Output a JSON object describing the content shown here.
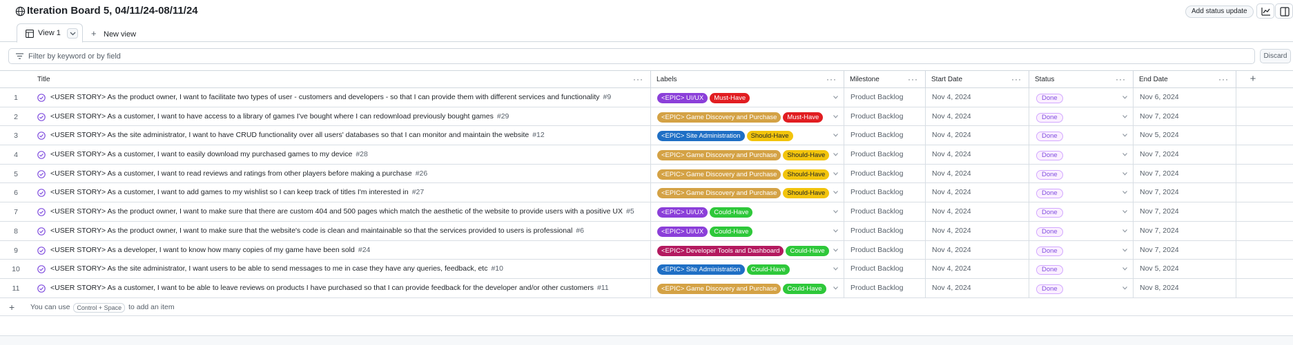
{
  "header": {
    "title": "Iteration Board 5, 04/11/24-08/11/24",
    "status_update_label": "Add status update"
  },
  "tabs": {
    "active": "View 1",
    "new_view": "New view"
  },
  "filter": {
    "placeholder": "Filter by keyword or by field",
    "discard_label": "Discard"
  },
  "columns": [
    "Title",
    "Labels",
    "Milestone",
    "Start Date",
    "Status",
    "End Date"
  ],
  "label_colors": {
    "<EPIC> UI/UX": "#8b3fd9",
    "<EPIC> Game Discovery and Purchase": "#d4a245",
    "<EPIC> Site Administration": "#1f6fc5",
    "<EPIC> Developer Tools and Dashboard": "#b3195f",
    "Must-Have": "#e11d21",
    "Should-Have": "#f2c40c",
    "Could-Have": "#2ec83a"
  },
  "dark_text_labels": [
    "Should-Have"
  ],
  "rows": [
    {
      "num": "1",
      "title": "<USER STORY> As the product owner, I want to facilitate two types of user - customers and developers - so that I can provide them with different services and functionality",
      "issue": "#9",
      "labels": [
        "<EPIC> UI/UX",
        "Must-Have"
      ],
      "milestone": "Product Backlog",
      "start": "Nov 4, 2024",
      "status": "Done",
      "end": "Nov 6, 2024"
    },
    {
      "num": "2",
      "title": "<USER STORY> As a customer, I want to have access to a library of games I've bought where I can redownload previously bought games",
      "issue": "#29",
      "labels": [
        "<EPIC> Game Discovery and Purchase",
        "Must-Have"
      ],
      "milestone": "Product Backlog",
      "start": "Nov 4, 2024",
      "status": "Done",
      "end": "Nov 7, 2024"
    },
    {
      "num": "3",
      "title": "<USER STORY> As the site administrator, I want to have CRUD functionality over all users' databases so that I can monitor and maintain the website",
      "issue": "#12",
      "labels": [
        "<EPIC> Site Administration",
        "Should-Have"
      ],
      "milestone": "Product Backlog",
      "start": "Nov 4, 2024",
      "status": "Done",
      "end": "Nov 5, 2024"
    },
    {
      "num": "4",
      "title": "<USER STORY> As a customer, I want to easily download my purchased games to my device",
      "issue": "#28",
      "labels": [
        "<EPIC> Game Discovery and Purchase",
        "Should-Have"
      ],
      "milestone": "Product Backlog",
      "start": "Nov 4, 2024",
      "status": "Done",
      "end": "Nov 7, 2024"
    },
    {
      "num": "5",
      "title": "<USER STORY> As a customer, I want to read reviews and ratings from other players before making a purchase",
      "issue": "#26",
      "labels": [
        "<EPIC> Game Discovery and Purchase",
        "Should-Have"
      ],
      "milestone": "Product Backlog",
      "start": "Nov 4, 2024",
      "status": "Done",
      "end": "Nov 7, 2024"
    },
    {
      "num": "6",
      "title": "<USER STORY> As a customer, I want to add games to my wishlist so I can keep track of titles I'm interested in",
      "issue": "#27",
      "labels": [
        "<EPIC> Game Discovery and Purchase",
        "Should-Have"
      ],
      "milestone": "Product Backlog",
      "start": "Nov 4, 2024",
      "status": "Done",
      "end": "Nov 7, 2024"
    },
    {
      "num": "7",
      "title": "<USER STORY> As the product owner, I want to make sure that there are custom 404 and 500 pages which match the aesthetic of the website to provide users with a positive UX",
      "issue": "#5",
      "labels": [
        "<EPIC> UI/UX",
        "Could-Have"
      ],
      "milestone": "Product Backlog",
      "start": "Nov 4, 2024",
      "status": "Done",
      "end": "Nov 7, 2024"
    },
    {
      "num": "8",
      "title": "<USER STORY> As the product owner, I want to make sure that the website's code is clean and maintainable so that the services provided to users is professional",
      "issue": "#6",
      "labels": [
        "<EPIC> UI/UX",
        "Could-Have"
      ],
      "milestone": "Product Backlog",
      "start": "Nov 4, 2024",
      "status": "Done",
      "end": "Nov 7, 2024"
    },
    {
      "num": "9",
      "title": "<USER STORY> As a developer, I want to know how many copies of my game have been sold",
      "issue": "#24",
      "labels": [
        "<EPIC> Developer Tools and Dashboard",
        "Could-Have"
      ],
      "milestone": "Product Backlog",
      "start": "Nov 4, 2024",
      "status": "Done",
      "end": "Nov 7, 2024"
    },
    {
      "num": "10",
      "title": "<USER STORY> As the site administrator, I want users to be able to send messages to me in case they have any queries, feedback, etc",
      "issue": "#10",
      "labels": [
        "<EPIC> Site Administration",
        "Could-Have"
      ],
      "milestone": "Product Backlog",
      "start": "Nov 4, 2024",
      "status": "Done",
      "end": "Nov 5, 2024"
    },
    {
      "num": "11",
      "title": "<USER STORY> As a customer, I want to be able to leave reviews on products I have purchased so that I can provide feedback for the developer and/or other customers",
      "issue": "#11",
      "labels": [
        "<EPIC> Game Discovery and Purchase",
        "Could-Have"
      ],
      "milestone": "Product Backlog",
      "start": "Nov 4, 2024",
      "status": "Done",
      "end": "Nov 8, 2024"
    }
  ],
  "add_item": {
    "prefix": "You can use",
    "shortcut": "Control + Space",
    "suffix": "to add an item"
  }
}
